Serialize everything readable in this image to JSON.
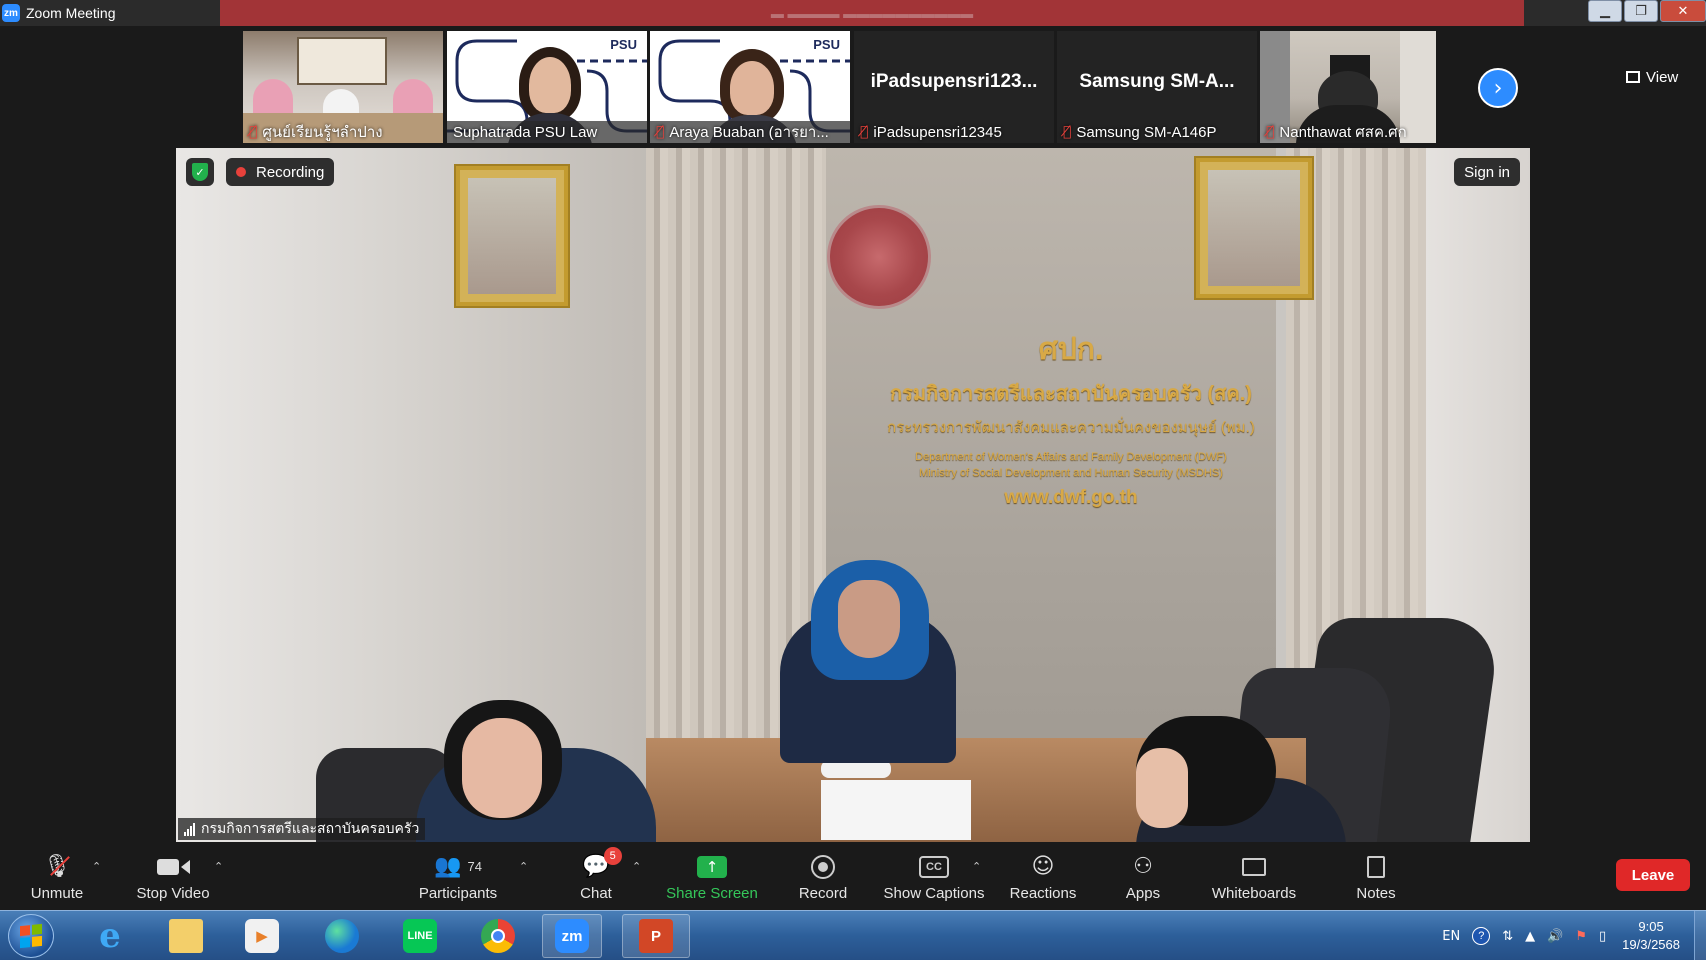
{
  "window": {
    "app_logo": "zm",
    "title": "Zoom Meeting",
    "controls": [
      "minimize",
      "restore",
      "close"
    ]
  },
  "thumbnails": [
    {
      "name": "ศูนย์เรียนรู้ฯลำปาง",
      "mic_muted": true
    },
    {
      "name": "Suphatrada PSU Law",
      "mic_muted": false
    },
    {
      "name": "Araya Buaban (อารยา...",
      "mic_muted": true
    },
    {
      "name": "iPadsupensri12345",
      "display_name": "iPadsupensri123...",
      "mic_muted": true
    },
    {
      "name": "Samsung SM-A146P",
      "display_name": "Samsung  SM-A...",
      "mic_muted": true
    },
    {
      "name": "Nanthawat ศสค.ศก",
      "mic_muted": true
    }
  ],
  "psu_logo": "PSU",
  "view_label": "View",
  "main_video": {
    "recording_label": "Recording",
    "sign_in_label": "Sign in",
    "speaker_name": "กรมกิจการสตรีและสถาบันครอบครัว",
    "sign_lines": [
      "ศปก.",
      "กรมกิจการสตรีและสถาบันครอบครัว (สค.)",
      "กระทรวงการพัฒนาสังคมและความมั่นคงของมนุษย์ (พม.)",
      "Department of Women's Affairs and Family Development (DWF)",
      "Ministry of Social Development and Human Security (MSDHS)",
      "www.dwf.go.th"
    ]
  },
  "toolbar": {
    "unmute": "Unmute",
    "stop_video": "Stop Video",
    "participants": "Participants",
    "participants_count": "74",
    "chat": "Chat",
    "chat_badge": "5",
    "share_screen": "Share Screen",
    "record": "Record",
    "show_captions": "Show Captions",
    "reactions": "Reactions",
    "apps": "Apps",
    "whiteboards": "Whiteboards",
    "notes": "Notes",
    "leave": "Leave",
    "cc_icon_text": "CC"
  },
  "taskbar": {
    "apps": [
      "start",
      "internet-explorer",
      "file-explorer",
      "media-player",
      "edge",
      "line",
      "chrome",
      "zoom",
      "powerpoint"
    ],
    "zoom_label": "zm",
    "line_label": "LINE",
    "ppt_label": "P",
    "language": "EN",
    "help": "?",
    "time": "9:05",
    "date": "19/3/2568"
  },
  "colors": {
    "accent_blue": "#2d8cff",
    "leave_red": "#e02828",
    "share_green": "#22b14c",
    "recording_red": "#e8413b"
  }
}
